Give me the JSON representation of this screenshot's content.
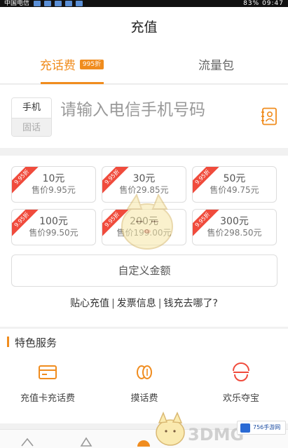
{
  "status_bar": {
    "carrier": "中国电信",
    "battery": "83%",
    "time": "09:47"
  },
  "title": "充值",
  "tabs": [
    {
      "label": "充话费",
      "badge": "995折"
    },
    {
      "label": "流量包"
    }
  ],
  "phone": {
    "type_options": [
      "手机",
      "固话"
    ],
    "placeholder": "请输入电信手机号码",
    "contact_icon": "contacts-icon"
  },
  "amounts": [
    {
      "face": "10元",
      "price": "售价9.95元",
      "discount": "9.95折"
    },
    {
      "face": "30元",
      "price": "售价29.85元",
      "discount": "9.95折"
    },
    {
      "face": "50元",
      "price": "售价49.75元",
      "discount": "9.95折"
    },
    {
      "face": "100元",
      "price": "售价99.50元",
      "discount": "9.95折"
    },
    {
      "face": "200元",
      "price": "售价199.00元",
      "discount": "9.95折"
    },
    {
      "face": "300元",
      "price": "售价298.50元",
      "discount": "9.95折"
    }
  ],
  "custom_amount_label": "自定义金额",
  "links": [
    "贴心充值",
    "发票信息",
    "钱充去哪了?"
  ],
  "link_separator": "|",
  "services": {
    "header": "特色服务",
    "items": [
      {
        "label": "充值卡充话费",
        "icon": "card-icon"
      },
      {
        "label": "摸话费",
        "icon": "coins-icon"
      },
      {
        "label": "欢乐夺宝",
        "icon": "smile-icon"
      }
    ]
  },
  "watermarks": {
    "brand1": "3DMG",
    "brand2": "756手游网"
  },
  "colors": {
    "accent": "#f08c1e",
    "ribbon": "#f04b3c"
  }
}
